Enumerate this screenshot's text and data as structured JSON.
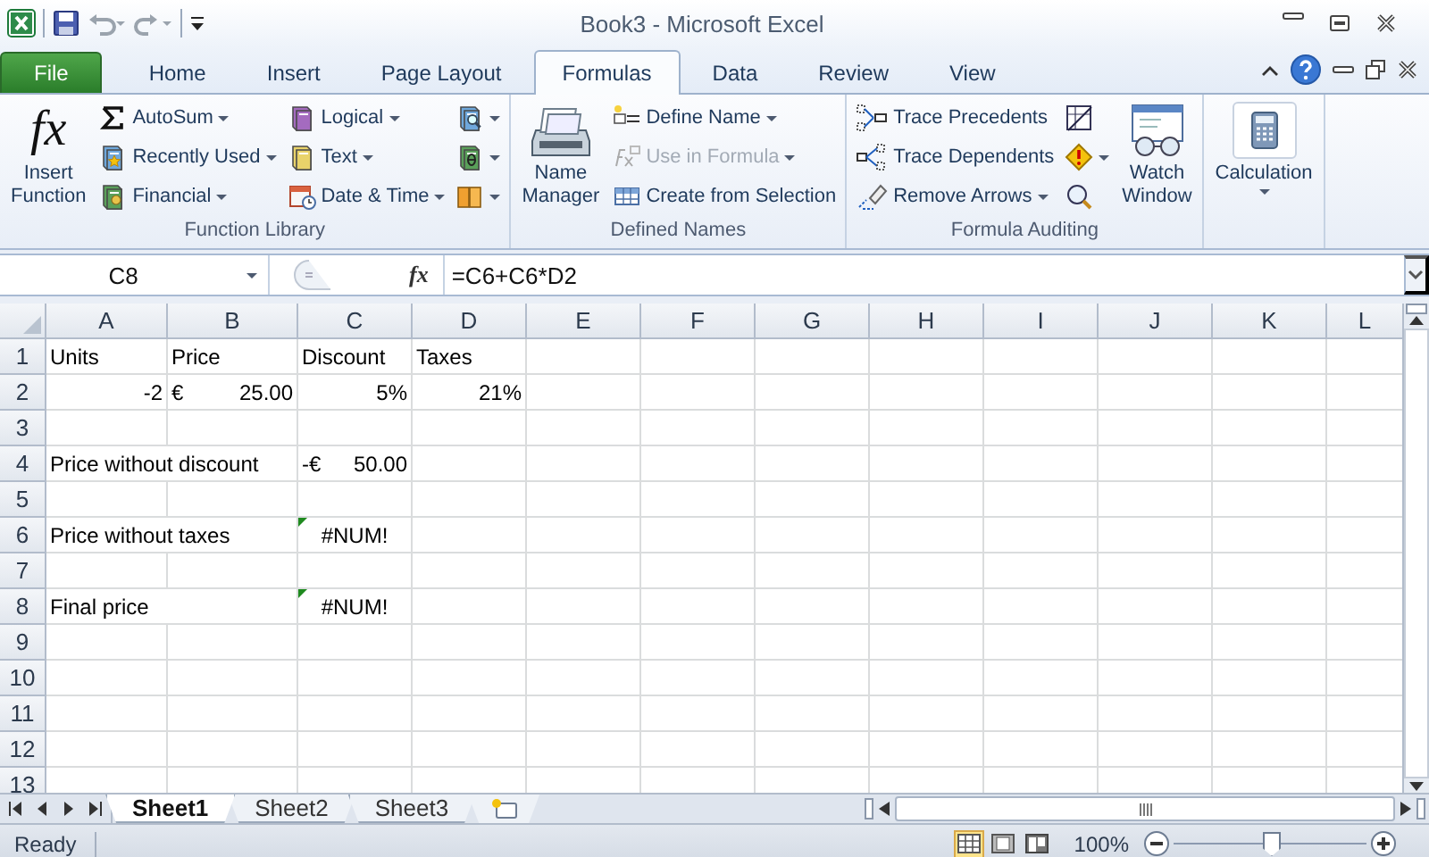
{
  "window": {
    "title": "Book3 - Microsoft Excel"
  },
  "tabs": [
    {
      "label": "File",
      "kind": "file",
      "selected": false
    },
    {
      "label": "Home",
      "kind": "tab",
      "selected": false
    },
    {
      "label": "Insert",
      "kind": "tab",
      "selected": false
    },
    {
      "label": "Page Layout",
      "kind": "tab",
      "selected": false
    },
    {
      "label": "Formulas",
      "kind": "tab",
      "selected": true
    },
    {
      "label": "Data",
      "kind": "tab",
      "selected": false
    },
    {
      "label": "Review",
      "kind": "tab",
      "selected": false
    },
    {
      "label": "View",
      "kind": "tab",
      "selected": false
    }
  ],
  "ribbon": {
    "groups": [
      {
        "label": "Function Library",
        "items": [
          {
            "kind": "large",
            "glyph": "fx",
            "label": "Insert Function",
            "dropdown": false
          },
          {
            "kind": "small",
            "label": "AutoSum",
            "dropdown": true,
            "disabled": false
          },
          {
            "kind": "small",
            "label": "Recently Used",
            "dropdown": true,
            "disabled": false
          },
          {
            "kind": "small",
            "label": "Financial",
            "dropdown": true,
            "disabled": false
          },
          {
            "kind": "small",
            "label": "Logical",
            "dropdown": true,
            "disabled": false
          },
          {
            "kind": "small",
            "label": "Text",
            "dropdown": true,
            "disabled": false
          },
          {
            "kind": "small",
            "label": "Date & Time",
            "dropdown": true,
            "disabled": false
          },
          {
            "kind": "icon",
            "dropdown": true
          },
          {
            "kind": "icon",
            "dropdown": true
          },
          {
            "kind": "icon",
            "dropdown": true
          }
        ]
      },
      {
        "label": "Defined Names",
        "items": [
          {
            "kind": "large",
            "label": "Name Manager",
            "dropdown": false
          },
          {
            "kind": "small",
            "label": "Define Name",
            "dropdown": true,
            "disabled": false
          },
          {
            "kind": "small",
            "label": "Use in Formula",
            "dropdown": true,
            "disabled": true
          },
          {
            "kind": "small",
            "label": "Create from Selection",
            "dropdown": false,
            "disabled": false
          }
        ]
      },
      {
        "label": "Formula Auditing",
        "items": [
          {
            "kind": "small",
            "label": "Trace Precedents",
            "dropdown": false,
            "disabled": false
          },
          {
            "kind": "small",
            "label": "Trace Dependents",
            "dropdown": false,
            "disabled": false
          },
          {
            "kind": "small",
            "label": "Remove Arrows",
            "dropdown": true,
            "disabled": false
          },
          {
            "kind": "icon",
            "dropdown": false
          },
          {
            "kind": "icon",
            "dropdown": true
          },
          {
            "kind": "icon",
            "dropdown": false
          },
          {
            "kind": "large",
            "label": "Watch Window",
            "dropdown": false
          }
        ]
      },
      {
        "items": [
          {
            "kind": "large",
            "label": "Calculation",
            "dropdown": true
          }
        ]
      }
    ]
  },
  "formula_bar": {
    "name_box": "C8",
    "function_glyph": "fx",
    "formula": "=C6+C6*D2"
  },
  "sheet": {
    "columns": [
      "A",
      "B",
      "C",
      "D",
      "E",
      "F",
      "G",
      "H",
      "I",
      "J",
      "K",
      "L"
    ],
    "rows": [
      {
        "number": "1",
        "cells": [
          {
            "kind": "text",
            "text": "Units"
          },
          {
            "kind": "text",
            "text": "Price"
          },
          {
            "kind": "text",
            "text": "Discount"
          },
          {
            "kind": "text",
            "text": "Taxes"
          }
        ]
      },
      {
        "number": "2",
        "cells": [
          {
            "kind": "number",
            "text": "-2"
          },
          {
            "kind": "accounting",
            "currency": "€",
            "value": "25.00"
          },
          {
            "kind": "number",
            "text": "5%"
          },
          {
            "kind": "number",
            "text": "21%"
          }
        ]
      },
      {
        "number": "3",
        "cells": []
      },
      {
        "number": "4",
        "cells": [
          {
            "kind": "text",
            "text": "Price without discount"
          },
          null,
          {
            "kind": "accounting",
            "currency": "-€",
            "value": "50.00"
          }
        ]
      },
      {
        "number": "5",
        "cells": []
      },
      {
        "number": "6",
        "cells": [
          {
            "kind": "text",
            "text": "Price without taxes"
          },
          null,
          {
            "kind": "error",
            "text": "#NUM!",
            "error_flag": true
          }
        ]
      },
      {
        "number": "7",
        "cells": []
      },
      {
        "number": "8",
        "cells": [
          {
            "kind": "text",
            "text": "Final price"
          },
          null,
          {
            "kind": "error",
            "text": "#NUM!",
            "error_flag": true
          }
        ]
      },
      {
        "number": "9",
        "cells": []
      },
      {
        "number": "10",
        "cells": []
      },
      {
        "number": "11",
        "cells": []
      },
      {
        "number": "12",
        "cells": []
      },
      {
        "number": "13",
        "cells": []
      }
    ]
  },
  "sheet_tabs": [
    {
      "label": "Sheet1",
      "selected": true
    },
    {
      "label": "Sheet2",
      "selected": false
    },
    {
      "label": "Sheet3",
      "selected": false
    }
  ],
  "status_bar": {
    "status": "Ready",
    "views": [
      {
        "selected": true
      },
      {
        "selected": false
      },
      {
        "selected": false
      }
    ],
    "zoom": {
      "reading": "100%",
      "level": 0.5
    }
  }
}
